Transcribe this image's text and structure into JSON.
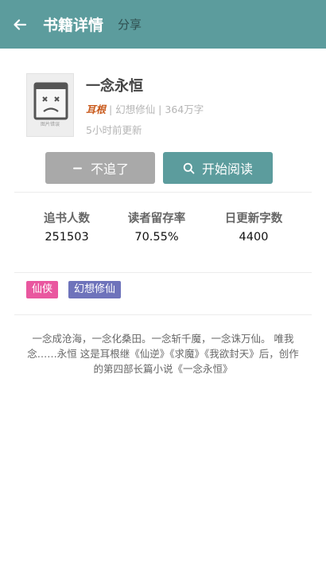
{
  "header": {
    "title": "书籍详情",
    "share_label": "分享",
    "background": "#5c9c9d"
  },
  "book": {
    "cover_placeholder": "图片错误",
    "title": "一念永恒",
    "author": "耳根",
    "separator": " | ",
    "genre": "幻想修仙",
    "word_count": "364万字",
    "updated": "5小时前更新"
  },
  "actions": {
    "unfollow_label": "不追了",
    "read_label": "开始阅读",
    "unfollow_color": "#a9a9a9",
    "read_color": "#5c9c9d"
  },
  "stats": [
    {
      "label": "追书人数",
      "value": "251503"
    },
    {
      "label": "读者留存率",
      "value": "70.55%"
    },
    {
      "label": "日更新字数",
      "value": "4400"
    }
  ],
  "tags": [
    {
      "label": "仙侠",
      "color": "#e9579f"
    },
    {
      "label": "幻想修仙",
      "color": "#6e73bb"
    }
  ],
  "summary": "一念成沧海，一念化桑田。一念斩千魔，一念诛万仙。 唯我念……永恒 这是耳根继《仙逆》《求魔》《我欲封天》后，创作的第四部长篇小说《一念永恒》"
}
